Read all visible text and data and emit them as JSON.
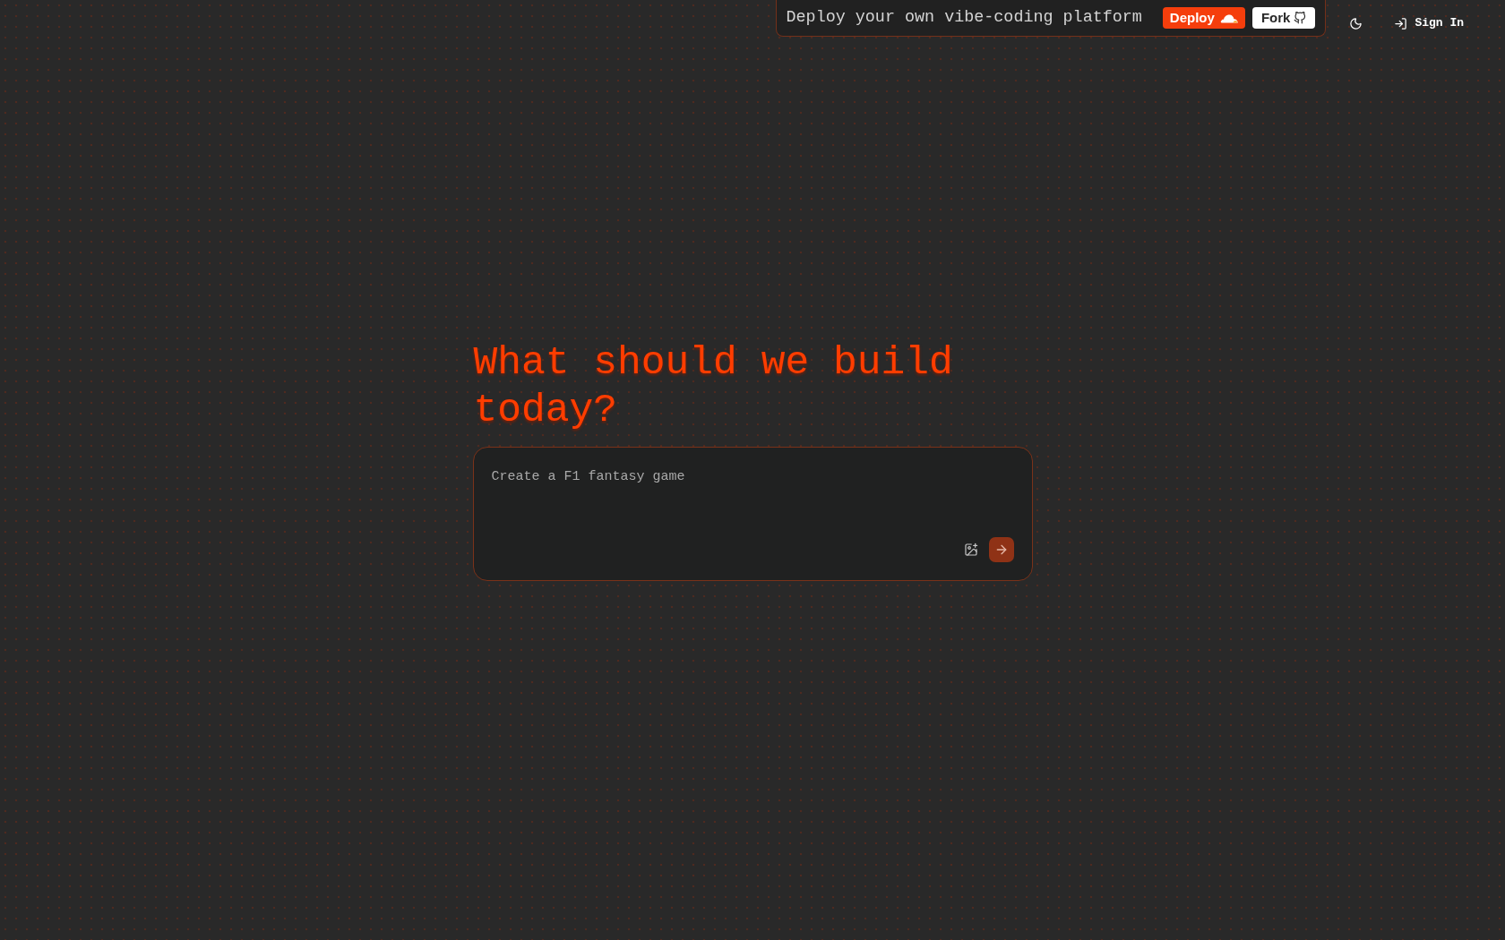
{
  "banner": {
    "text": "Deploy your own vibe-coding platform",
    "deploy_button": "Deploy",
    "fork_button": "Fork"
  },
  "header": {
    "sign_in": "Sign In"
  },
  "heading": "What should we build today?",
  "prompt": {
    "placeholder": "Create a F1 fantasy game"
  }
}
